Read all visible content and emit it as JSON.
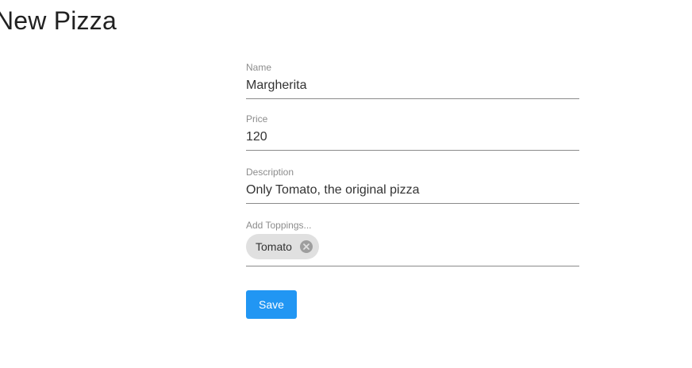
{
  "page": {
    "title": "New Pizza"
  },
  "form": {
    "name": {
      "label": "Name",
      "value": "Margherita"
    },
    "price": {
      "label": "Price",
      "value": "120"
    },
    "description": {
      "label": "Description",
      "value": "Only Tomato, the original pizza"
    },
    "toppings": {
      "label": "Add Toppings...",
      "chips": [
        {
          "label": "Tomato",
          "remove_icon": "cancel-circle-icon"
        }
      ]
    },
    "save_label": "Save"
  },
  "colors": {
    "primary": "#2196f3",
    "chip_background": "#e0e0e0",
    "label_text": "#8c8c8c",
    "underline": "#8a8a8a"
  }
}
